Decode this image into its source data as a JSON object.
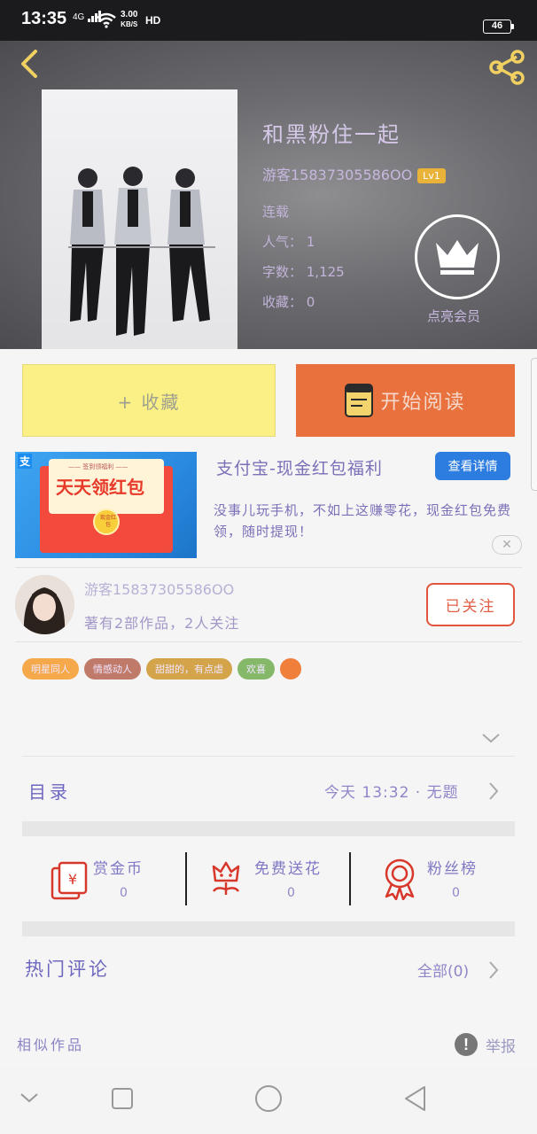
{
  "status_bar": {
    "time": "13:35",
    "network": "4G",
    "speed_value": "3.00",
    "speed_unit": "KB/S",
    "hd": "HD",
    "battery": "46"
  },
  "book": {
    "title": "和黑粉住一起",
    "author": "游客15837305586OO",
    "level": "Lv1",
    "status": "连载",
    "popularity": "人气： 1",
    "word_count": "字数： 1,125",
    "favorites": "收藏： 0",
    "vip_label": "点亮会员"
  },
  "actions": {
    "collect": "+ 收藏",
    "read": "开始阅读"
  },
  "ad": {
    "image_banner": "天天领红包",
    "image_ribbon": "—— 签到领福利 ——",
    "image_coin": "现金红包",
    "image_brand": "支",
    "title": "支付宝-现金红包福利",
    "detail_button": "查看详情",
    "description": "没事儿玩手机，不如上这赚零花，现金红包免费领，随时提现！",
    "close": "✕"
  },
  "author_card": {
    "name": "游客15837305586OO",
    "stats": "著有2部作品，2人关注",
    "follow_button": "已关注"
  },
  "tags": [
    {
      "label": "明星同人",
      "color": "#f5a94b"
    },
    {
      "label": "情感动人",
      "color": "#c07a6a"
    },
    {
      "label": "甜甜的，有点虐",
      "color": "#d4a44b"
    },
    {
      "label": "欢喜",
      "color": "#86b86a"
    }
  ],
  "catalog": {
    "label": "目录",
    "latest": "今天 13:32 · 无题"
  },
  "stats_row": [
    {
      "label": "赏金币",
      "count": "0"
    },
    {
      "label": "免费送花",
      "count": "0"
    },
    {
      "label": "粉丝榜",
      "count": "0"
    }
  ],
  "comments": {
    "label": "热门评论",
    "all": "全部(0)"
  },
  "footer": {
    "similar": "相似作品",
    "report": "举报"
  },
  "colors": {
    "accent_orange": "#e9713d",
    "collect_yellow": "#faf085",
    "text_purple": "#7d6fb8",
    "follow_red": "#e0553b"
  }
}
